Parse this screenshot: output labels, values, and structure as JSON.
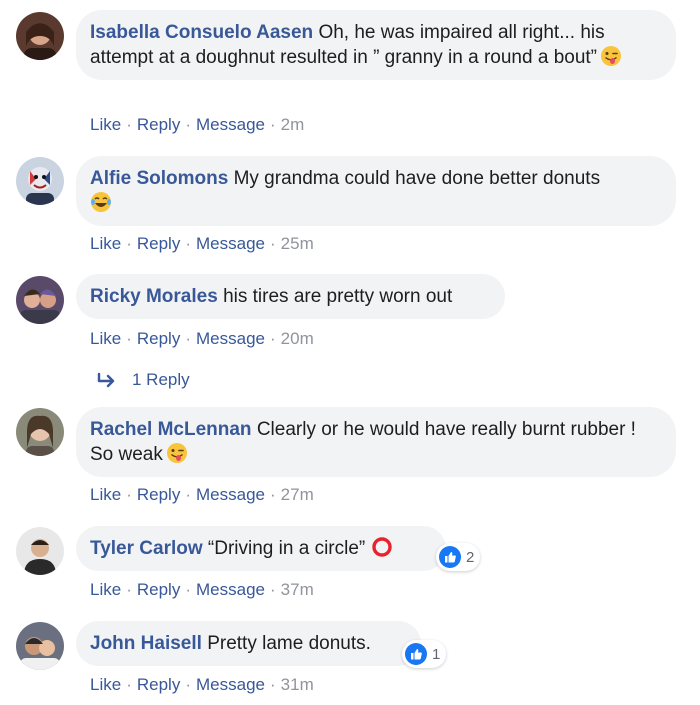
{
  "comments": [
    {
      "author": "Isabella Consuelo Aasen",
      "text": "Oh, he was impaired all right... his attempt at a doughnut resulted in ” granny in a round a bout”",
      "emoji": "winking-tongue-emoji",
      "time": "2m"
    },
    {
      "author": "Alfie Solomons",
      "text": "My grandma could have done better donuts",
      "emoji": "tears-of-joy-emoji",
      "time": "25m"
    },
    {
      "author": "Ricky Morales",
      "text": "his tires are pretty worn out",
      "time": "20m",
      "replies_label": "1 Reply"
    },
    {
      "author": "Rachel McLennan",
      "text": "Clearly or he would have really burnt rubber ! So weak",
      "emoji": "winking-tongue-emoji",
      "time": "27m"
    },
    {
      "author": "Tyler Carlow",
      "text": "“Driving in a circle”",
      "emoji": "red-circle-emoji",
      "time": "37m",
      "reaction_count": "2"
    },
    {
      "author": "John Haisell",
      "text": "Pretty lame donuts.",
      "time": "31m",
      "reaction_count": "1"
    }
  ],
  "actions": {
    "like": "Like",
    "reply": "Reply",
    "message": "Message",
    "separator": "·"
  },
  "colors": {
    "link": "#385898",
    "bubble": "#f2f3f5",
    "meta": "#90949c",
    "like_blue": "#1877f2"
  }
}
